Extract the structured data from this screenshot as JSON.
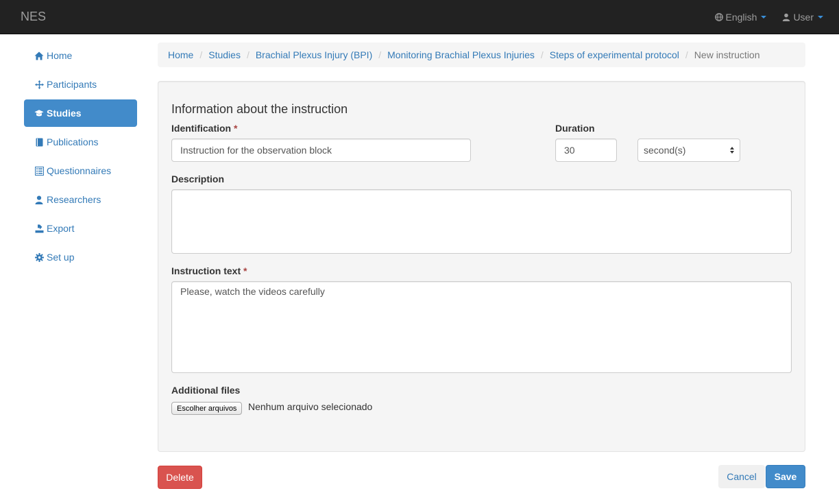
{
  "navbar": {
    "brand": "NES",
    "language_label": "English",
    "user_label": "User",
    "icons": [
      "globe-icon",
      "user-icon"
    ]
  },
  "sidebar": {
    "items": [
      {
        "label": "Home",
        "icon": "home-icon",
        "active": false
      },
      {
        "label": "Participants",
        "icon": "move-icon",
        "active": false
      },
      {
        "label": "Studies",
        "icon": "graduation-cap-icon",
        "active": true
      },
      {
        "label": "Publications",
        "icon": "book-icon",
        "active": false
      },
      {
        "label": "Questionnaires",
        "icon": "list-icon",
        "active": false
      },
      {
        "label": "Researchers",
        "icon": "user-icon",
        "active": false
      },
      {
        "label": "Export",
        "icon": "export-icon",
        "active": false
      },
      {
        "label": "Set up",
        "icon": "cog-icon",
        "active": false
      }
    ]
  },
  "breadcrumb": [
    "Home",
    "Studies",
    "Brachial Plexus Injury (BPI)",
    "Monitoring Brachial Plexus Injuries",
    "Steps of experimental protocol",
    "New instruction"
  ],
  "form": {
    "title": "Information about the instruction",
    "identification_label": "Identification",
    "identification_value": "Instruction for the observation block",
    "duration_label": "Duration",
    "duration_value": "30",
    "duration_unit": "second(s)",
    "description_label": "Description",
    "description_value": "",
    "instruction_text_label": "Instruction text",
    "instruction_text_value": "Please, watch the videos carefully",
    "required_marker": "*",
    "additional_files_label": "Additional files",
    "file_button_label": "Escolher arquivos",
    "file_status": "Nenhum arquivo selecionado"
  },
  "actions": {
    "delete_label": "Delete",
    "cancel_label": "Cancel",
    "save_label": "Save"
  },
  "colors": {
    "navbar_bg": "#222222",
    "link": "#337ab7",
    "primary": "#428bca",
    "danger": "#d9534f"
  }
}
